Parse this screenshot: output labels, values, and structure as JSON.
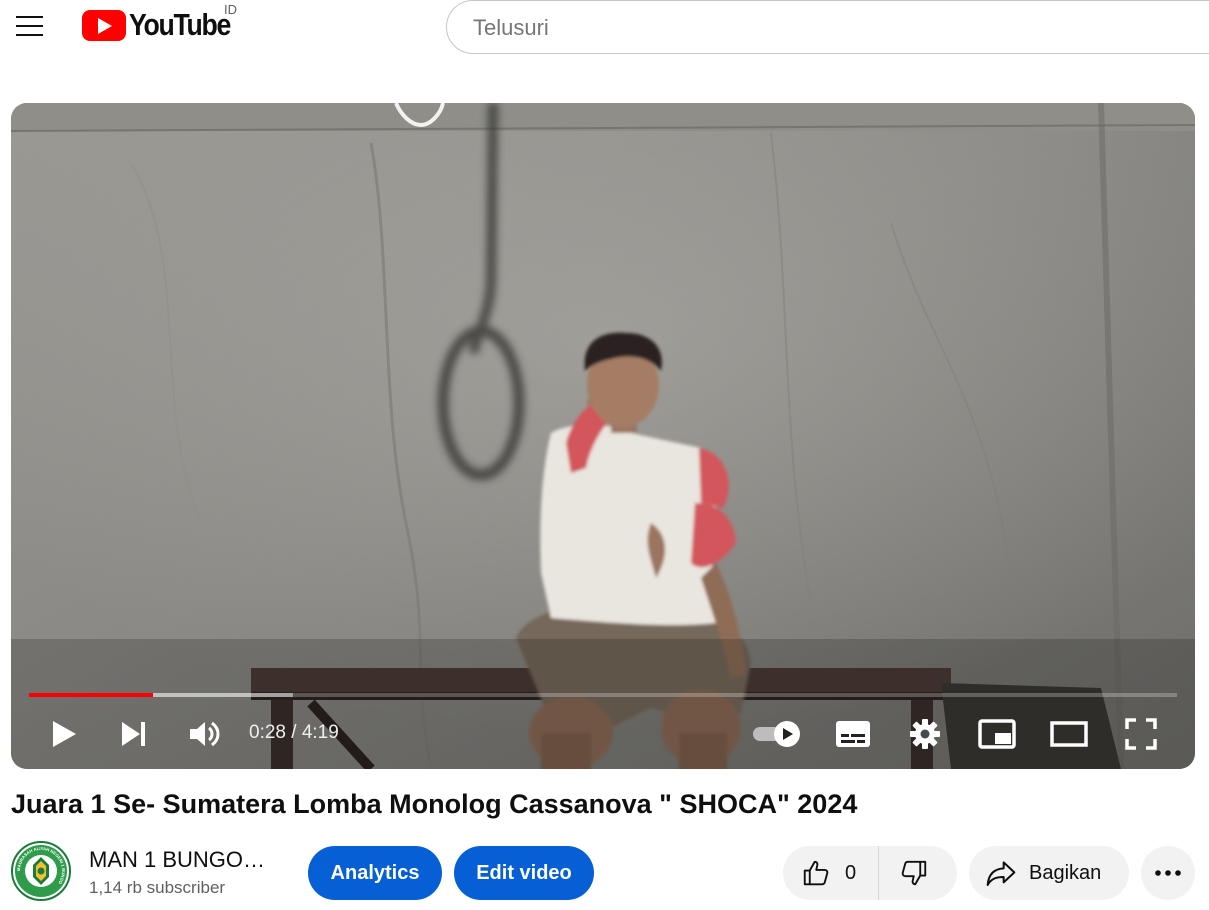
{
  "header": {
    "logo_text": "YouTube",
    "country_code": "ID",
    "search_placeholder": "Telusuri"
  },
  "player": {
    "current_time": "0:28",
    "duration": "4:19",
    "played_fraction": 0.108,
    "buffered_fraction": 0.23
  },
  "video": {
    "title": "Juara 1 Se- Sumatera Lomba Monolog Cassanova \" SHOCA\" 2024"
  },
  "owner": {
    "channel_name": "MAN 1 BUNGO…",
    "subscribers": "1,14 rb subscriber",
    "avatar_text": "MADRASAH ALIYAH NEGERI 1 BUNGO"
  },
  "actions": {
    "analytics_label": "Analytics",
    "edit_label": "Edit video",
    "like_count": "0",
    "share_label": "Bagikan"
  },
  "colors": {
    "brand_red": "#ff0000",
    "primary_blue": "#065fd4",
    "progress_red": "#ff0000"
  }
}
